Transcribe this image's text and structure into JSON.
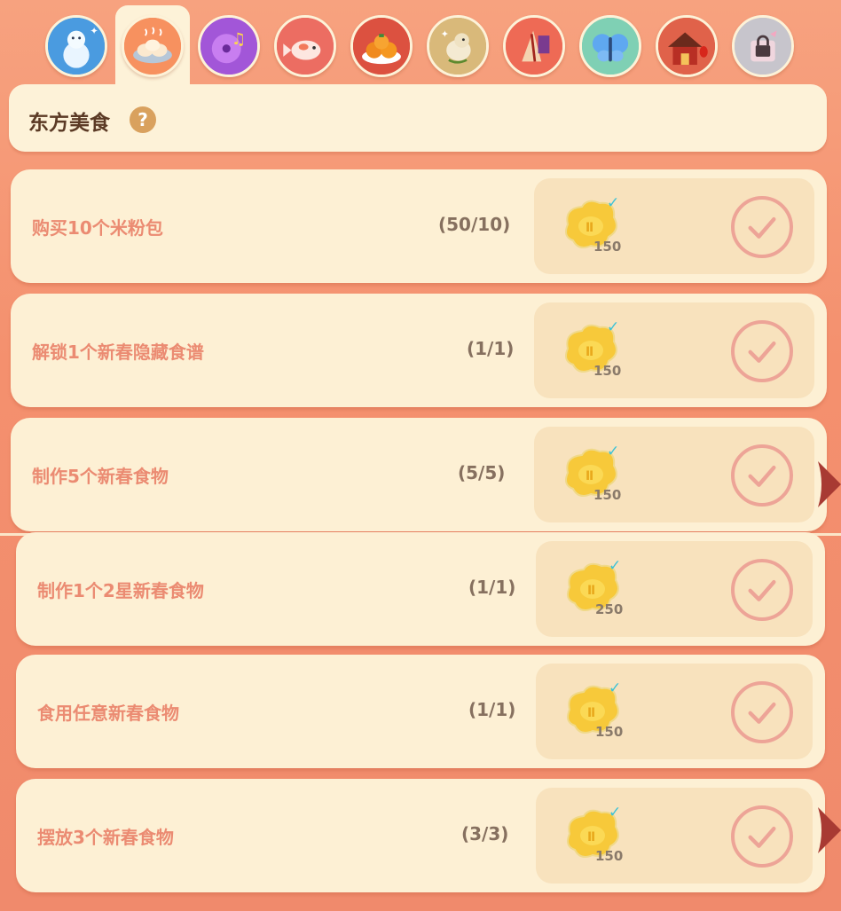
{
  "tabs": [
    {
      "id": "snowman",
      "icon": "snowman-icon"
    },
    {
      "id": "food",
      "icon": "dumplings-icon",
      "active": true
    },
    {
      "id": "music",
      "icon": "music-disc-icon"
    },
    {
      "id": "koi",
      "icon": "koi-fish-icon"
    },
    {
      "id": "fruit",
      "icon": "persimmon-plate-icon"
    },
    {
      "id": "bird",
      "icon": "sparrow-icon"
    },
    {
      "id": "kite",
      "icon": "kite-icon"
    },
    {
      "id": "butterfly",
      "icon": "butterfly-icon"
    },
    {
      "id": "house",
      "icon": "lantern-house-icon"
    },
    {
      "id": "locked",
      "icon": "lock-gift-icon"
    }
  ],
  "section": {
    "title": "东方美食",
    "help_label": "?"
  },
  "tasks": [
    {
      "label": "购买10个米粉包",
      "progress": "(50/10)",
      "reward": "150",
      "claimed": true
    },
    {
      "label": "解锁1个新春隐藏食谱",
      "progress": "(1/1)",
      "reward": "150",
      "claimed": true
    },
    {
      "label": "制作5个新春食物",
      "progress": "(5/5)",
      "reward": "150",
      "claimed": true
    },
    {
      "label": "制作1个2星新春食物",
      "progress": "(1/1)",
      "reward": "250",
      "claimed": true
    },
    {
      "label": "食用任意新春食物",
      "progress": "(1/1)",
      "reward": "150",
      "claimed": true
    },
    {
      "label": "摆放3个新春食物",
      "progress": "(3/3)",
      "reward": "150",
      "claimed": true
    }
  ],
  "reward_check": "✓",
  "colors": {
    "accent": "#eb8b72",
    "panel": "#fdf0d4",
    "coin": "#f7c93a",
    "check": "#3ec2d6"
  }
}
